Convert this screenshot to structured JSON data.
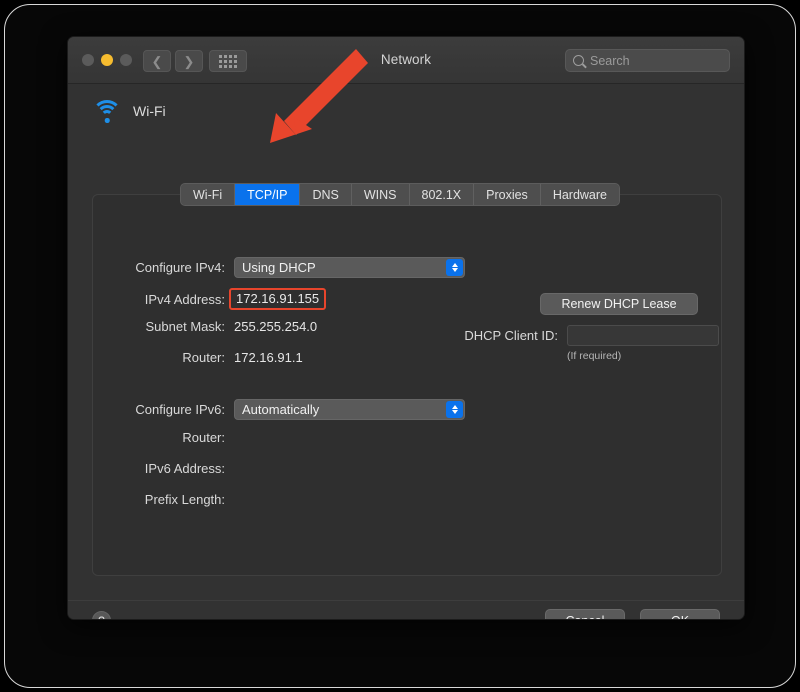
{
  "window": {
    "title": "Network",
    "traffic_lights": [
      "close",
      "minimize",
      "zoom"
    ],
    "nav_back_icon": "chevron-left-icon",
    "nav_forward_icon": "chevron-right-icon",
    "show_all_icon": "grid-icon"
  },
  "search": {
    "placeholder": "Search",
    "value": "",
    "icon": "search-icon"
  },
  "service": {
    "name": "Wi-Fi",
    "icon": "wifi-icon"
  },
  "tabs": [
    {
      "label": "Wi-Fi",
      "active": false
    },
    {
      "label": "TCP/IP",
      "active": true
    },
    {
      "label": "DNS",
      "active": false
    },
    {
      "label": "WINS",
      "active": false
    },
    {
      "label": "802.1X",
      "active": false
    },
    {
      "label": "Proxies",
      "active": false
    },
    {
      "label": "Hardware",
      "active": false
    }
  ],
  "ipv4": {
    "configure_label": "Configure IPv4:",
    "configure_value": "Using DHCP",
    "address_label": "IPv4 Address:",
    "address_value": "172.16.91.155",
    "subnet_label": "Subnet Mask:",
    "subnet_value": "255.255.254.0",
    "router_label": "Router:",
    "router_value": "172.16.91.1",
    "renew_button": "Renew DHCP Lease",
    "dhcp_client_id_label": "DHCP Client ID:",
    "dhcp_client_id_value": "",
    "dhcp_hint": "(If required)"
  },
  "ipv6": {
    "configure_label": "Configure IPv6:",
    "configure_value": "Automatically",
    "router_label": "Router:",
    "router_value": "",
    "address_label": "IPv6 Address:",
    "address_value": "",
    "prefix_label": "Prefix Length:",
    "prefix_value": ""
  },
  "footer": {
    "help_label": "?",
    "cancel_label": "Cancel",
    "ok_label": "OK"
  },
  "annotation": {
    "arrow_color": "#e8452c",
    "points_to": "TCP/IP",
    "highlight_color": "#e8452c",
    "highlight_target": "172.16.91.155"
  },
  "colors": {
    "accent_blue": "#0a72ec",
    "wifi_blue": "#1e8fe8",
    "window_bg": "#323232",
    "panel_bg": "#2f2f2f",
    "annotation_red": "#e8452c"
  }
}
